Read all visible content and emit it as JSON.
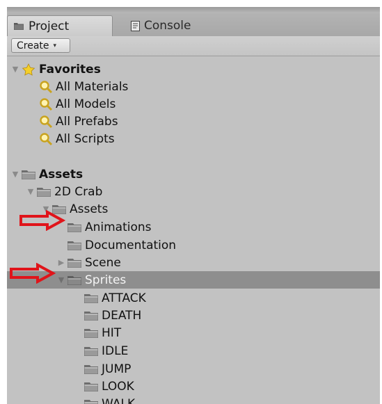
{
  "tabs": [
    {
      "label": "Project",
      "icon": "folder-icon",
      "active": true
    },
    {
      "label": "Console",
      "icon": "console-icon",
      "active": false
    }
  ],
  "toolbar": {
    "create_label": "Create",
    "caret": "▾"
  },
  "tree": {
    "favorites": {
      "label": "Favorites",
      "icon": "star-folder-icon",
      "items": [
        "All Materials",
        "All Models",
        "All Prefabs",
        "All Scripts"
      ]
    },
    "assets": {
      "label": "Assets",
      "crab": "2D Crab",
      "crab_assets": "Assets",
      "children": [
        "Animations",
        "Documentation",
        "Scene",
        "Sprites"
      ],
      "selected": "Sprites",
      "sprite_children": [
        "ATTACK",
        "DEATH",
        "HIT",
        "IDLE",
        "JUMP",
        "LOOK",
        "WALK"
      ]
    }
  },
  "colors": {
    "panel_bg": "#c2c2c2",
    "selection_bg": "#8e8e8e",
    "annotation_arrow": "#e0141a",
    "search_icon": "#d9b82a"
  }
}
